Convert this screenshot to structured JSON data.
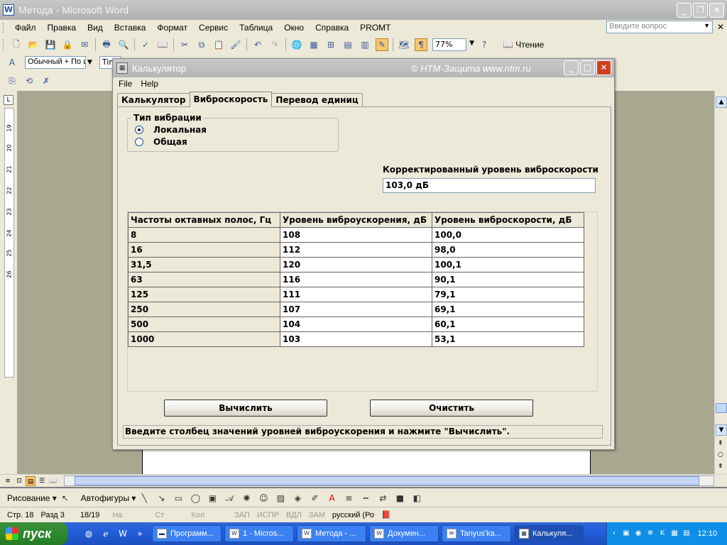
{
  "word": {
    "title": "Метода - Microsoft Word",
    "icon_letter": "W",
    "window_buttons": [
      "_",
      "❐",
      "✕"
    ],
    "menu": [
      "Файл",
      "Правка",
      "Вид",
      "Вставка",
      "Формат",
      "Сервис",
      "Таблица",
      "Окно",
      "Справка",
      "PROMT"
    ],
    "question_placeholder": "Введите вопрос",
    "zoom": "77%",
    "read_label": "Чтение",
    "style_value": "Обычный + По ц",
    "font_value": "Time",
    "ruler_numbers": [
      "19",
      "20",
      "21",
      "22",
      "23",
      "24",
      "25",
      "26"
    ],
    "drawing_label": "Рисование ▾",
    "autoshapes_label": "Автофигуры ▾",
    "status": {
      "page": "Стр.  18",
      "section": "Разд  3",
      "pages": "18/19",
      "at": "На",
      "line": "Ст",
      "col": "Кол",
      "rec": "ЗАП",
      "trk": "ИСПР",
      "ext": "ВДЛ",
      "ovr": "ЗАМ",
      "lang": "русский (Ро"
    }
  },
  "taskbar": {
    "start_label": "пуск",
    "tasks": [
      {
        "label": "Программ...",
        "icon": "folder-icon"
      },
      {
        "label": "1 - Micros...",
        "icon": "word-icon"
      },
      {
        "label": "Метода - ...",
        "icon": "word-icon"
      },
      {
        "label": "Докумен...",
        "icon": "word-icon"
      },
      {
        "label": "Tanyus'ka...",
        "icon": "chat-icon"
      },
      {
        "label": "Калькуля...",
        "icon": "calculator-icon"
      }
    ],
    "clock": "12:10"
  },
  "calculator": {
    "title": "Калькулятор",
    "copyright": "© НТМ-Защита www.ntm.ru",
    "menu": [
      "File",
      "Help"
    ],
    "tabs": [
      "Калькулятор",
      "Виброскорость",
      "Перевод единиц"
    ],
    "active_tab": 1,
    "vibration_group": {
      "legend": "Тип вибрации",
      "options": [
        "Локальная",
        "Общая"
      ],
      "selected": 0
    },
    "corrected_level_label": "Корректированный уровень виброскорости",
    "corrected_level_value": "103,0 дБ",
    "table": {
      "headers": [
        "Частоты октавных полос, Гц",
        "Уровень виброускорения, дБ",
        "Уровень виброскорости, дБ"
      ],
      "rows": [
        [
          "8",
          "108",
          "100,0"
        ],
        [
          "16",
          "112",
          "98,0"
        ],
        [
          "31,5",
          "120",
          "100,1"
        ],
        [
          "63",
          "116",
          "90,1"
        ],
        [
          "125",
          "111",
          "79,1"
        ],
        [
          "250",
          "107",
          "69,1"
        ],
        [
          "500",
          "104",
          "60,1"
        ],
        [
          "1000",
          "103",
          "53,1"
        ]
      ]
    },
    "buttons": {
      "calculate": "Вычислить",
      "clear": "Очистить"
    },
    "status_message": "Введите столбец значений уровней виброускорения и нажмите \"Вычислить\"."
  }
}
